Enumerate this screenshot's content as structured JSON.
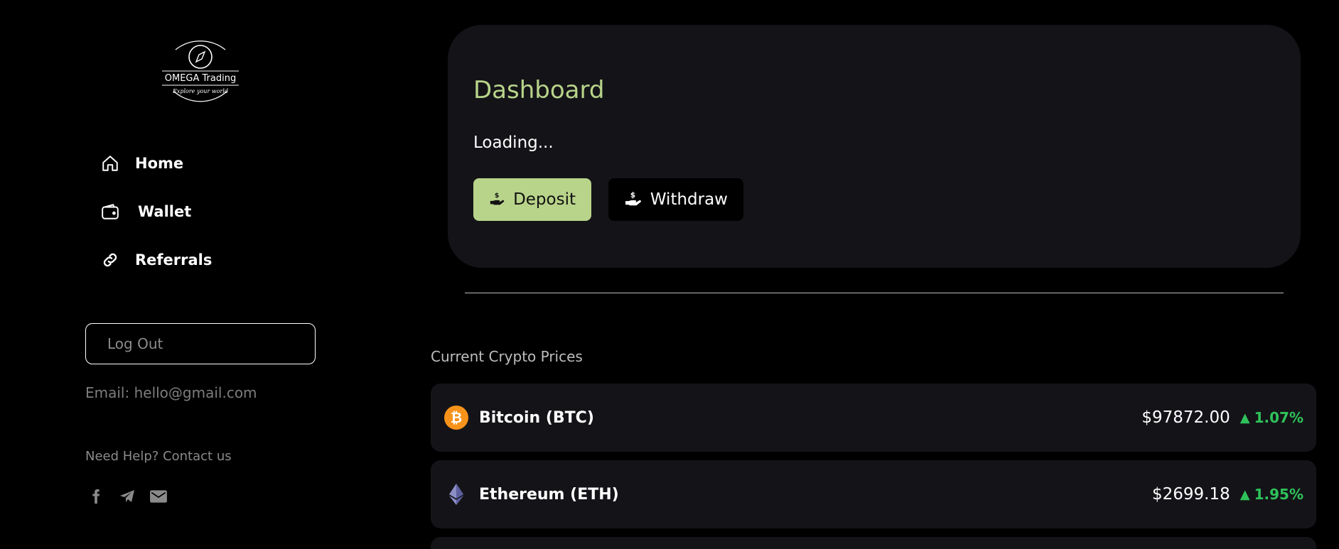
{
  "brand": {
    "name": "OMEGA Trading",
    "tagline": "Explore your world"
  },
  "sidebar": {
    "items": [
      {
        "label": "Home",
        "icon": "home-icon"
      },
      {
        "label": "Wallet",
        "icon": "wallet-icon"
      },
      {
        "label": "Referrals",
        "icon": "link-icon"
      }
    ],
    "logout_label": "Log Out",
    "email_text": "Email: hello@gmail.com",
    "help_text": "Need Help? Contact us",
    "socials": [
      "facebook-icon",
      "telegram-icon",
      "mail-icon"
    ]
  },
  "dashboard": {
    "title": "Dashboard",
    "status": "Loading...",
    "deposit_label": "Deposit",
    "withdraw_label": "Withdraw"
  },
  "prices": {
    "title": "Current Crypto Prices",
    "rows": [
      {
        "name": "Bitcoin (BTC)",
        "price": "$97872.00",
        "change": "1.07%",
        "icon": "bitcoin-icon"
      },
      {
        "name": "Ethereum (ETH)",
        "price": "$2699.18",
        "change": "1.95%",
        "icon": "ethereum-icon"
      }
    ]
  },
  "colors": {
    "accent": "#b8d48a",
    "card_bg": "#141418",
    "positive": "#2fc25b",
    "bitcoin": "#f7931a"
  }
}
